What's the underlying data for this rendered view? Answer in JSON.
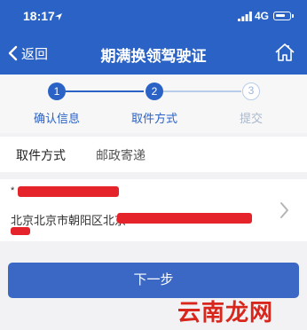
{
  "status_bar": {
    "time": "18:17",
    "network": "4G",
    "icons": [
      "location-arrow-icon",
      "signal-icon",
      "battery-icon"
    ]
  },
  "header": {
    "back_label": "返回",
    "title": "期满换领驾驶证",
    "home_icon": "home-icon",
    "background": "#2b62c5"
  },
  "steps": [
    {
      "number": "1",
      "label": "确认信息",
      "state": "done"
    },
    {
      "number": "2",
      "label": "取件方式",
      "state": "active"
    },
    {
      "number": "3",
      "label": "提交",
      "state": "pending"
    }
  ],
  "pickup": {
    "label": "取件方式",
    "value": "邮政寄递"
  },
  "address": {
    "prefix": "*",
    "text": "北京北京市朝阳区北京",
    "chevron_icon": "chevron-right-icon"
  },
  "next_button": {
    "label": "下一步",
    "color": "#3a68c4"
  },
  "watermark": {
    "text": "云南龙网"
  },
  "colors": {
    "accent": "#2b62c5",
    "redaction": "#e4242a",
    "inactive": "#b8cde9"
  }
}
